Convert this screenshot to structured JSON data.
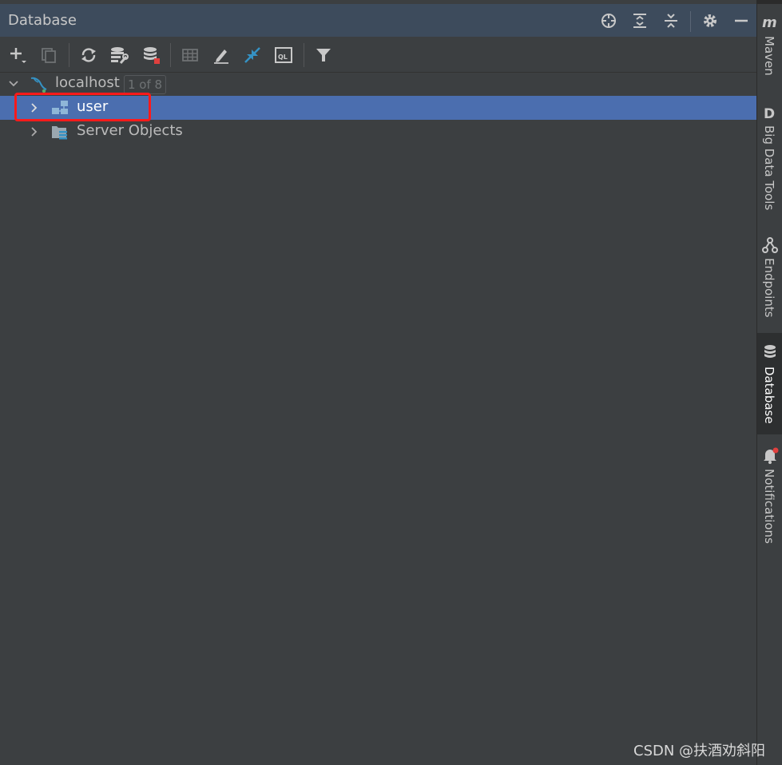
{
  "window": {
    "title": "Database"
  },
  "tree": {
    "root": {
      "label": "localhost",
      "badge": "1 of 8"
    },
    "items": [
      {
        "label": "user",
        "selected": true
      },
      {
        "label": "Server Objects",
        "selected": false
      }
    ]
  },
  "sidebar": {
    "tabs": [
      {
        "label": "Maven",
        "icon": "maven-icon"
      },
      {
        "label": "Big Data Tools",
        "icon": "big-data-tools-icon"
      },
      {
        "label": "Endpoints",
        "icon": "endpoints-icon"
      },
      {
        "label": "Database",
        "icon": "database-icon",
        "active": true
      },
      {
        "label": "Notifications",
        "icon": "bell-icon"
      }
    ]
  },
  "watermark": {
    "text": "CSDN @扶酒劝斜阳"
  },
  "colors": {
    "header_bg": "#3d4b5c",
    "panel_bg": "#3c3f41",
    "selection": "#4b6eaf",
    "highlight_box": "#ff1a1a",
    "accent_blue": "#3592c4"
  }
}
